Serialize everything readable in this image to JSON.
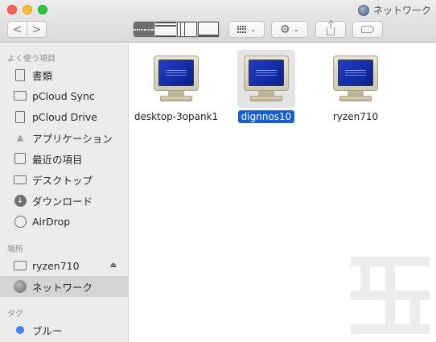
{
  "window": {
    "title": "ネットワーク"
  },
  "toolbar": {
    "back": "<",
    "forward": ">",
    "group_chevron": "⌄",
    "action_chevron": "⌄",
    "gear": "⚙"
  },
  "sidebar": {
    "favorites_title": "よく使う項目",
    "favorites": [
      {
        "label": "書類",
        "icon": "document-icon"
      },
      {
        "label": "pCloud Sync",
        "icon": "folder-icon"
      },
      {
        "label": "pCloud Drive",
        "icon": "document-icon"
      },
      {
        "label": "アプリケーション",
        "icon": "applications-icon"
      },
      {
        "label": "最近の項目",
        "icon": "recents-icon"
      },
      {
        "label": "デスクトップ",
        "icon": "desktop-icon"
      },
      {
        "label": "ダウンロード",
        "icon": "download-icon"
      },
      {
        "label": "AirDrop",
        "icon": "airdrop-icon"
      }
    ],
    "locations_title": "場所",
    "locations": [
      {
        "label": "ryzen710",
        "icon": "display-icon"
      },
      {
        "label": "ネットワーク",
        "icon": "network-icon"
      }
    ],
    "tags_title": "タグ",
    "tags": [
      {
        "label": "ブルー",
        "color": "#3b82f6"
      }
    ]
  },
  "content": {
    "items": [
      {
        "label": "desktop-3opank1",
        "selected": false
      },
      {
        "label": "dignnos10",
        "selected": true
      },
      {
        "label": "ryzen710",
        "selected": false
      }
    ]
  },
  "colors": {
    "selection": "#1660d6",
    "sidebar_selected": "#d4d4d4"
  }
}
